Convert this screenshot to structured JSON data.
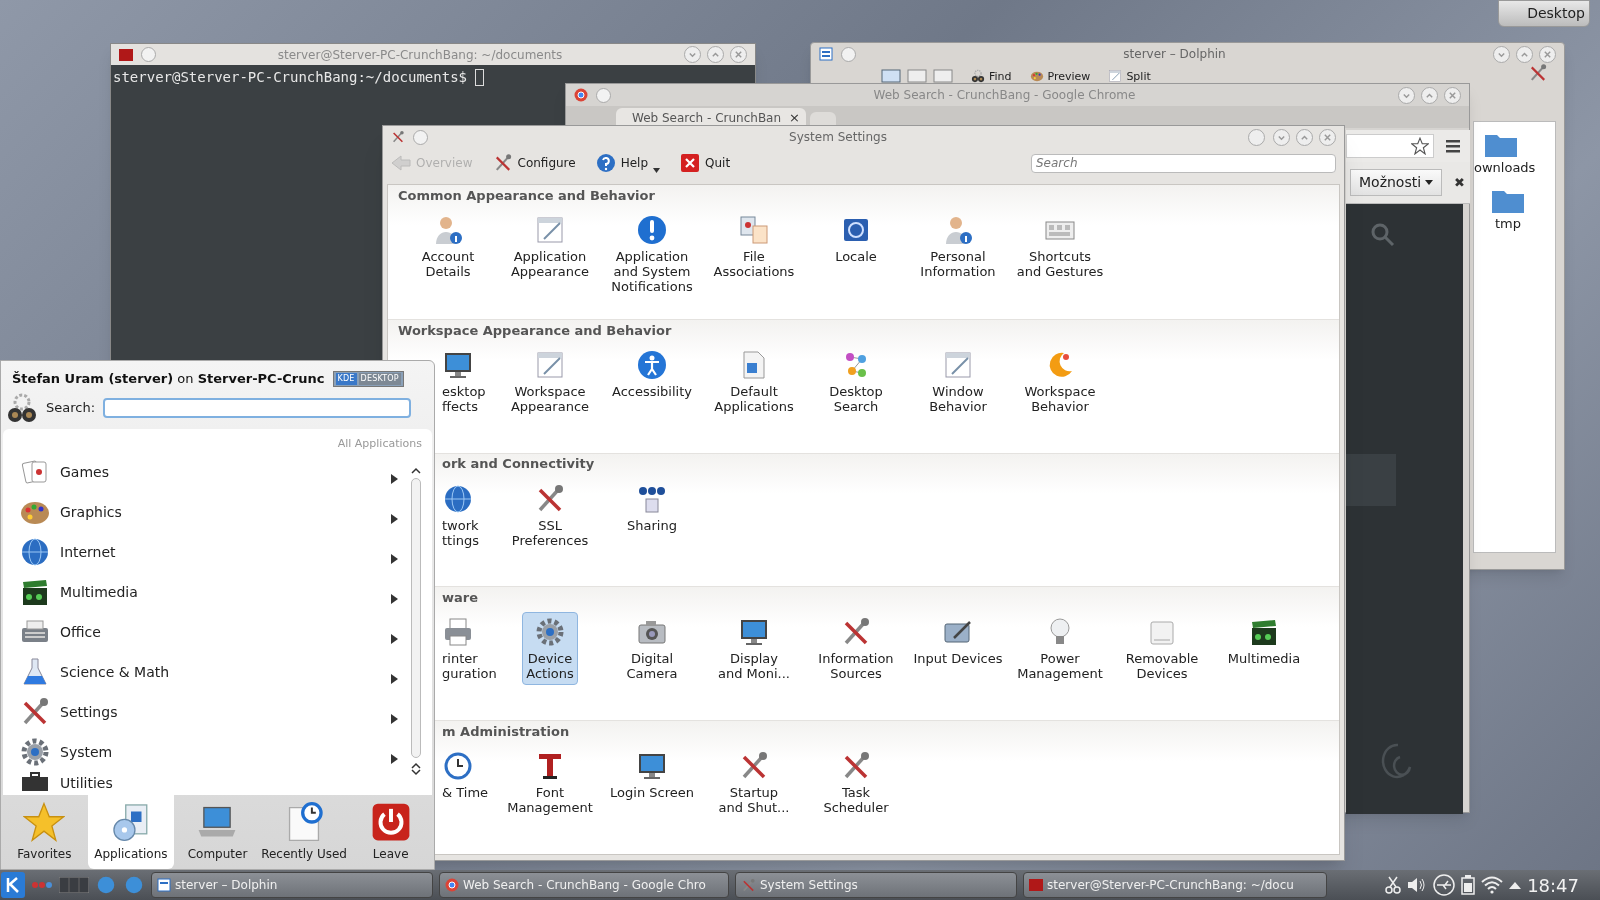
{
  "desktop_button": "Desktop",
  "terminal": {
    "title": "sterver@Sterver-PC-CrunchBang: ~/documents",
    "prompt": "sterver@Sterver-PC-CrunchBang:~/documents$"
  },
  "dolphin": {
    "title": "sterver – Dolphin",
    "toolbar": [
      "Find",
      "Preview",
      "Split"
    ],
    "places": [
      "ownloads",
      "tmp"
    ]
  },
  "chrome": {
    "title": "Web Search - CrunchBang - Google Chrome",
    "tab": "Web Search - CrunchBan",
    "close_tab": "×",
    "options_button": "Možnosti",
    "close_bar": "✖"
  },
  "system_settings": {
    "title": "System Settings",
    "search_placeholder": "Search",
    "toolbar": [
      {
        "label": "Overview",
        "disabled": true
      },
      {
        "label": "Configure",
        "disabled": false
      },
      {
        "label": "Help",
        "disabled": false
      },
      {
        "label": "Quit",
        "disabled": false
      }
    ],
    "sections": [
      {
        "title": "Common Appearance and Behavior",
        "items": [
          {
            "label": "Account\nDetails",
            "selected": false
          },
          {
            "label": "Application\nAppearance",
            "selected": false
          },
          {
            "label": "Application\nand System\nNotifications",
            "selected": false
          },
          {
            "label": "File\nAssociations",
            "selected": false
          },
          {
            "label": "Locale",
            "selected": false
          },
          {
            "label": "Personal\nInformation",
            "selected": false
          },
          {
            "label": "Shortcuts\nand Gestures",
            "selected": false
          }
        ]
      },
      {
        "title": "Workspace Appearance and Behavior",
        "items": [
          {
            "label": "esktop\nffects",
            "selected": false
          },
          {
            "label": "Workspace\nAppearance",
            "selected": false
          },
          {
            "label": "Accessibility",
            "selected": false
          },
          {
            "label": "Default\nApplications",
            "selected": false
          },
          {
            "label": "Desktop\nSearch",
            "selected": false
          },
          {
            "label": "Window\nBehavior",
            "selected": false
          },
          {
            "label": "Workspace\nBehavior",
            "selected": false
          }
        ]
      },
      {
        "title": "ork and Connectivity",
        "items": [
          {
            "label": "twork\nttings",
            "selected": false
          },
          {
            "label": "SSL\nPreferences",
            "selected": false
          },
          {
            "label": "Sharing",
            "selected": false
          }
        ]
      },
      {
        "title": "ware",
        "items": [
          {
            "label": "rinter\nguration",
            "selected": false
          },
          {
            "label": "Device\nActions",
            "selected": true
          },
          {
            "label": "Digital\nCamera",
            "selected": false
          },
          {
            "label": "Display\nand Moni...",
            "selected": false
          },
          {
            "label": "Information\nSources",
            "selected": false
          },
          {
            "label": "Input Devices",
            "selected": false
          },
          {
            "label": "Power\nManagement",
            "selected": false
          },
          {
            "label": "Removable\nDevices",
            "selected": false
          },
          {
            "label": "Multimedia",
            "selected": false
          }
        ]
      },
      {
        "title": "m Administration",
        "items": [
          {
            "label": "& Time",
            "selected": false
          },
          {
            "label": "Font\nManagement",
            "selected": false
          },
          {
            "label": "Login Screen",
            "selected": false
          },
          {
            "label": "Startup\nand Shut...",
            "selected": false
          },
          {
            "label": "Task\nScheduler",
            "selected": false
          }
        ]
      }
    ]
  },
  "launcher": {
    "header": "**Štefan Uram (sterver)** on **Sterver-PC-Crunc**",
    "badge": [
      "KDE",
      "DESKTOP"
    ],
    "search_label": "Search:",
    "breadcrumb": "All Applications",
    "categories": [
      "Games",
      "Graphics",
      "Internet",
      "Multimedia",
      "Office",
      "Science & Math",
      "Settings",
      "System",
      "Utilities"
    ],
    "tabs": [
      {
        "label": "Favorites",
        "selected": false
      },
      {
        "label": "Applications",
        "selected": true
      },
      {
        "label": "Computer",
        "selected": false
      },
      {
        "label": "Recently Used",
        "selected": false
      },
      {
        "label": "Leave",
        "selected": false
      }
    ]
  },
  "taskbar": {
    "tasks": [
      "sterver – Dolphin",
      "Web Search - CrunchBang - Google Chro",
      "System Settings",
      "sterver@Sterver-PC-CrunchBang: ~/docu"
    ],
    "clock": "18:47"
  }
}
